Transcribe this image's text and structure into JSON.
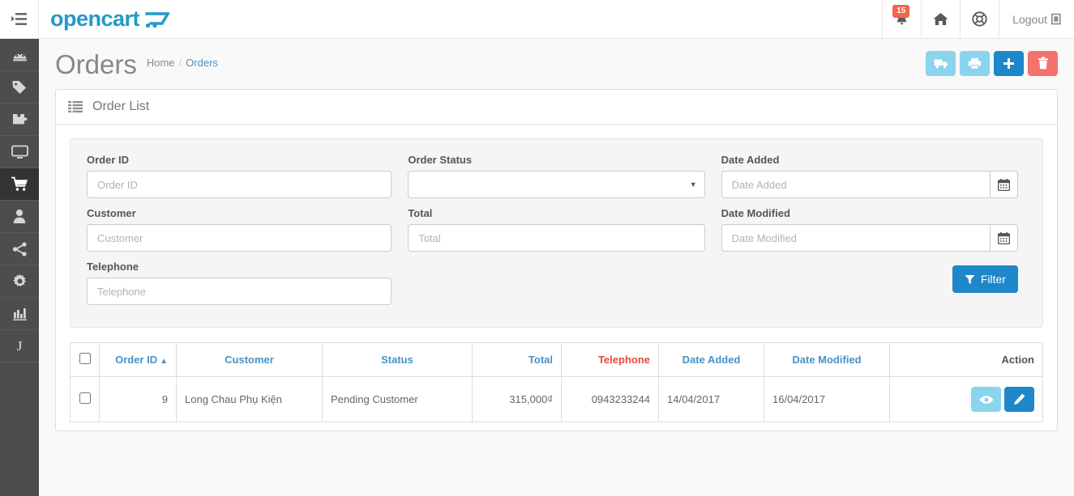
{
  "header": {
    "brand": "opencart",
    "brand_icon": "shopping-cart-logo-icon",
    "toggle_icon": "sidebar-toggle-icon",
    "notification_count": "15",
    "notification_icon": "bell-icon",
    "home_icon": "home-icon",
    "support_icon": "lifebuoy-icon",
    "logout_label": "Logout",
    "logout_icon": "sign-out-icon"
  },
  "sidebar": {
    "items": [
      {
        "name": "dashboard",
        "icon": "dashboard-gauge-icon",
        "active": false
      },
      {
        "name": "catalog",
        "icon": "tags-icon",
        "active": false
      },
      {
        "name": "extensions",
        "icon": "puzzle-piece-icon",
        "active": false
      },
      {
        "name": "design",
        "icon": "desktop-monitor-icon",
        "active": false
      },
      {
        "name": "sales",
        "icon": "shopping-cart-icon",
        "active": true
      },
      {
        "name": "customers",
        "icon": "user-icon",
        "active": false
      },
      {
        "name": "marketing",
        "icon": "share-alt-icon",
        "active": false
      },
      {
        "name": "system",
        "icon": "gear-icon",
        "active": false
      },
      {
        "name": "reports",
        "icon": "bar-chart-icon",
        "active": false
      },
      {
        "name": "journal",
        "icon": "letter-j",
        "label": "J",
        "active": false
      }
    ]
  },
  "page": {
    "title": "Orders",
    "breadcrumb": [
      {
        "label": "Home",
        "active": false
      },
      {
        "label": "Orders",
        "active": true
      }
    ],
    "actions": [
      {
        "name": "shipping",
        "icon": "truck-icon",
        "style": "info"
      },
      {
        "name": "print-invoice",
        "icon": "printer-icon",
        "style": "info"
      },
      {
        "name": "add-new",
        "icon": "plus-icon",
        "style": "primary"
      },
      {
        "name": "delete",
        "icon": "trash-icon",
        "style": "danger"
      }
    ]
  },
  "panel": {
    "title": "Order List",
    "icon": "list-icon"
  },
  "filter": {
    "order_id": {
      "label": "Order ID",
      "placeholder": "Order ID",
      "value": ""
    },
    "order_status": {
      "label": "Order Status",
      "selected": "",
      "options": [
        ""
      ]
    },
    "date_added": {
      "label": "Date Added",
      "placeholder": "Date Added",
      "value": "",
      "icon": "calendar-icon"
    },
    "customer": {
      "label": "Customer",
      "placeholder": "Customer",
      "value": ""
    },
    "total": {
      "label": "Total",
      "placeholder": "Total",
      "value": ""
    },
    "date_modified": {
      "label": "Date Modified",
      "placeholder": "Date Modified",
      "value": "",
      "icon": "calendar-icon"
    },
    "telephone": {
      "label": "Telephone",
      "placeholder": "Telephone",
      "value": ""
    },
    "submit": {
      "label": "Filter",
      "icon": "funnel-icon"
    }
  },
  "table": {
    "columns": [
      {
        "key": "check",
        "label": "",
        "sortable": false,
        "color": "dark"
      },
      {
        "key": "order_id",
        "label": "Order ID",
        "sortable": true,
        "color": "blue",
        "sort": "asc"
      },
      {
        "key": "customer",
        "label": "Customer",
        "sortable": true,
        "color": "blue"
      },
      {
        "key": "status",
        "label": "Status",
        "sortable": true,
        "color": "blue"
      },
      {
        "key": "total",
        "label": "Total",
        "sortable": true,
        "color": "blue"
      },
      {
        "key": "telephone",
        "label": "Telephone",
        "sortable": true,
        "color": "red"
      },
      {
        "key": "date_added",
        "label": "Date Added",
        "sortable": true,
        "color": "blue"
      },
      {
        "key": "date_modified",
        "label": "Date Modified",
        "sortable": true,
        "color": "blue"
      },
      {
        "key": "action",
        "label": "Action",
        "sortable": false,
        "color": "dark"
      }
    ],
    "rows": [
      {
        "order_id": "9",
        "customer": "Long Chau Phụ Kiện",
        "status": "Pending Customer",
        "total": "315,000₫",
        "telephone": "0943233244",
        "date_added": "14/04/2017",
        "date_modified": "16/04/2017",
        "actions": [
          {
            "name": "view-order",
            "icon": "eye-icon",
            "style": "info"
          },
          {
            "name": "edit-order",
            "icon": "pencil-icon",
            "style": "primary"
          }
        ]
      }
    ]
  },
  "colors": {
    "brand_blue": "#229ac8",
    "primary": "#1e87c9",
    "info": "#8ad4ee",
    "danger": "#f4726a",
    "link_blue": "#4a91c4",
    "sort_red": "#e8483d",
    "sidebar_bg": "#4d4d4d",
    "page_bg": "#f9f9f9"
  }
}
